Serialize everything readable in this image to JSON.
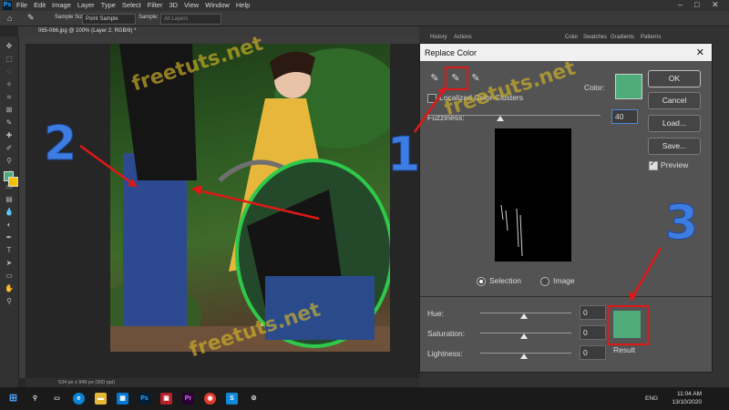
{
  "app": {
    "menu": [
      "File",
      "Edit",
      "Image",
      "Layer",
      "Type",
      "Select",
      "Filter",
      "3D",
      "View",
      "Window",
      "Help"
    ],
    "options": {
      "sample_size_label": "Sample Size:",
      "sample_size_value": "Point Sample",
      "sample_label": "Sample:",
      "sample_value": "All Layers"
    },
    "document_tab": "065-066.jpg @ 100% (Layer 2, RGB/8) *",
    "status": "534 px x 949 px (300 ppi)",
    "panel_tabs_top": [
      "History",
      "Actions"
    ],
    "panel_tabs_color": [
      "Color",
      "Swatches",
      "Gradients",
      "Patterns"
    ]
  },
  "dialog": {
    "title": "Replace Color",
    "color_label": "Color:",
    "localized_label": "Localized Color Clusters",
    "fuzziness_label": "Fuzziness:",
    "fuzziness_value": "40",
    "ok": "OK",
    "cancel": "Cancel",
    "load": "Load...",
    "save": "Save...",
    "preview": "Preview",
    "preview_checked": true,
    "selection_label": "Selection",
    "image_label": "Image",
    "hue_label": "Hue:",
    "hue_value": "0",
    "saturation_label": "Saturation:",
    "saturation_value": "0",
    "lightness_label": "Lightness:",
    "lightness_value": "0",
    "result_label": "Result",
    "swatch_color": "#4eac7b"
  },
  "annotations": {
    "step1": "1",
    "step2": "2",
    "step3": "3",
    "watermark": "freetuts.net"
  },
  "taskbar": {
    "time": "11:04 AM",
    "date": "13/10/2020",
    "lang": "ENG"
  }
}
